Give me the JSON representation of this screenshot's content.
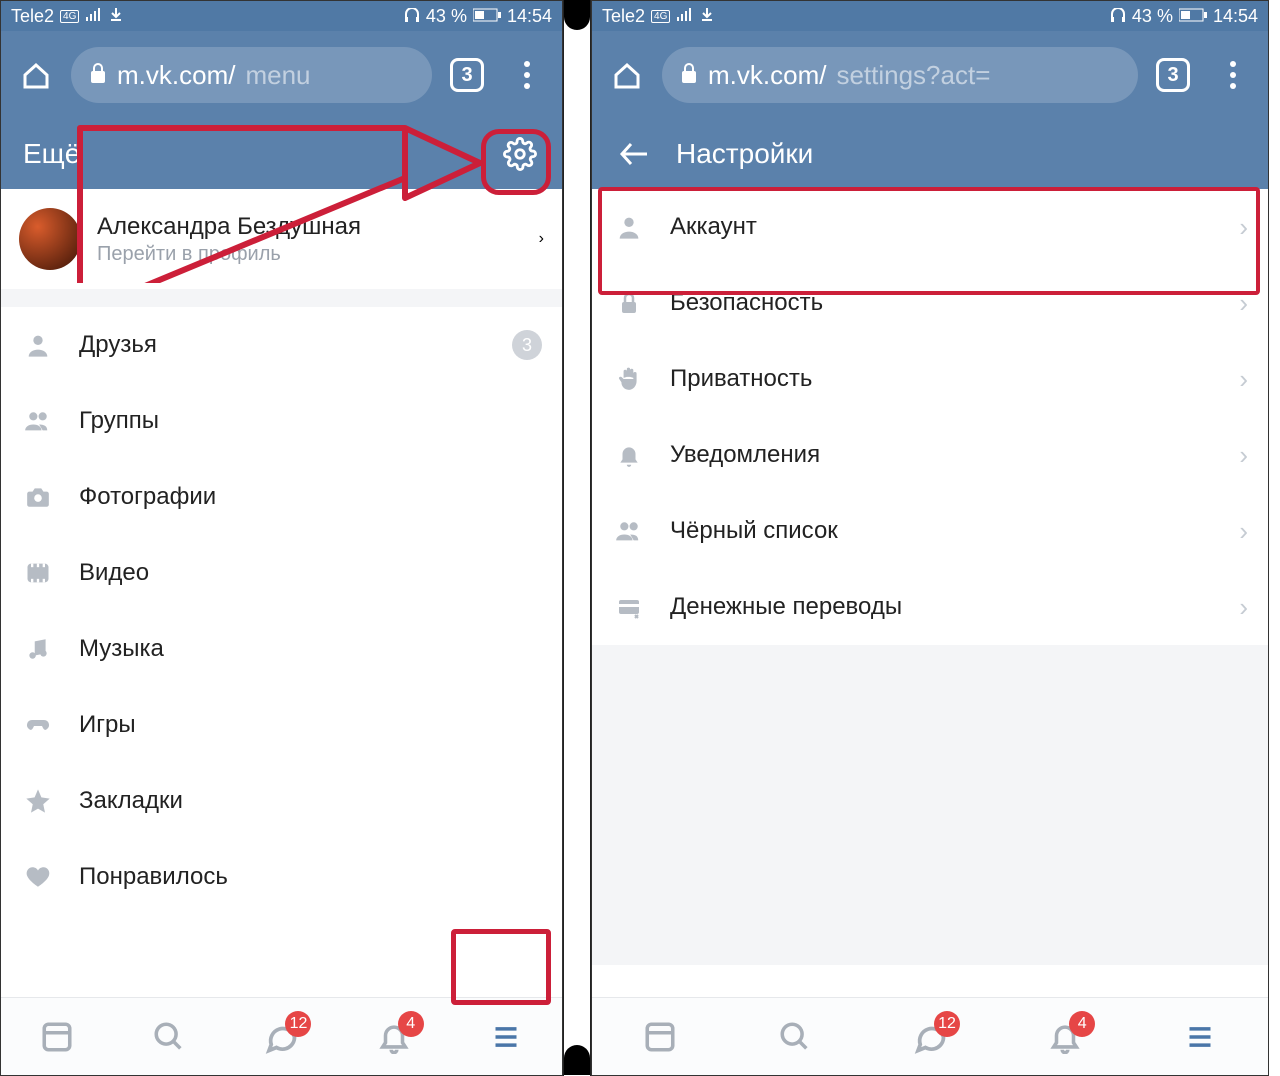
{
  "status": {
    "carrier": "Tele2",
    "net": "4G",
    "battery_pct": "43 %",
    "time": "14:54"
  },
  "browser_left": {
    "host": "m.vk.com/",
    "path": "menu",
    "tabs": "3"
  },
  "browser_right": {
    "host": "m.vk.com/",
    "path": "settings?act=",
    "tabs": "3"
  },
  "left": {
    "appbar_title": "Ещё",
    "profile": {
      "name": "Александра Бездушная",
      "sub": "Перейти в профиль"
    },
    "menu": [
      {
        "icon": "person",
        "label": "Друзья",
        "badge": "3"
      },
      {
        "icon": "groups",
        "label": "Группы"
      },
      {
        "icon": "camera",
        "label": "Фотографии"
      },
      {
        "icon": "video",
        "label": "Видео"
      },
      {
        "icon": "music",
        "label": "Музыка"
      },
      {
        "icon": "games",
        "label": "Игры"
      },
      {
        "icon": "star",
        "label": "Закладки"
      },
      {
        "icon": "heart",
        "label": "Понравилось"
      }
    ],
    "bottom_badges": {
      "messages": "12",
      "notifications": "4"
    }
  },
  "right": {
    "appbar_title": "Настройки",
    "items": [
      {
        "icon": "person",
        "label": "Аккаунт"
      },
      {
        "icon": "lock",
        "label": "Безопасность"
      },
      {
        "icon": "hand",
        "label": "Приватность"
      },
      {
        "icon": "bell",
        "label": "Уведомления"
      },
      {
        "icon": "groups",
        "label": "Чёрный список"
      },
      {
        "icon": "card",
        "label": "Денежные переводы"
      }
    ],
    "bottom_badges": {
      "messages": "12",
      "notifications": "4"
    }
  }
}
